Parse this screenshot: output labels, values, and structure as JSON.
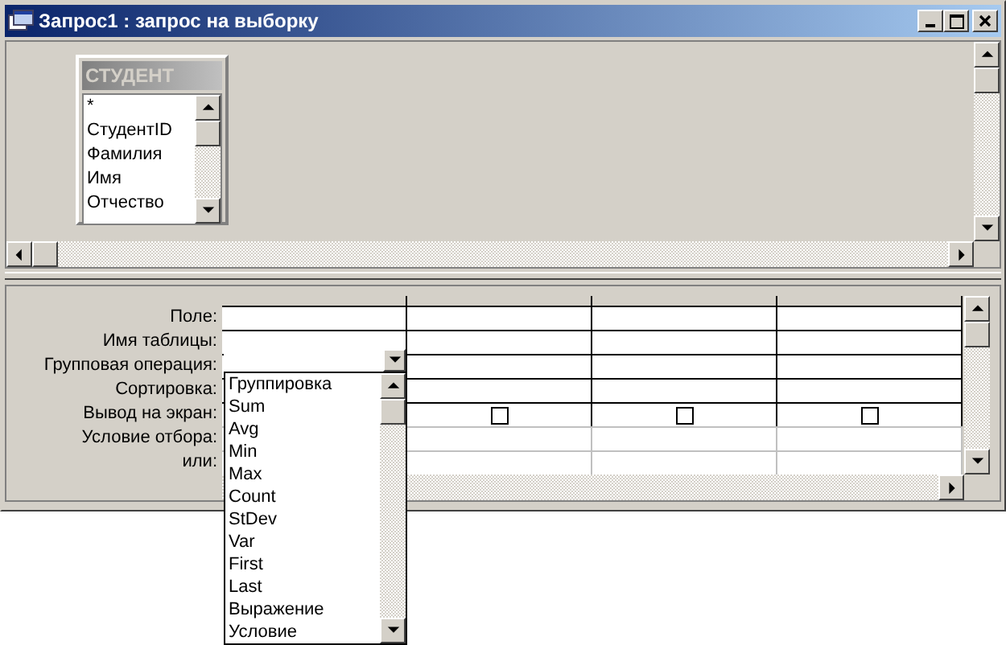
{
  "window": {
    "title": "Запрос1 : запрос на выборку"
  },
  "table_box": {
    "title": "СТУДЕНТ",
    "fields": [
      "*",
      "СтудентID",
      "Фамилия",
      "Имя",
      "Отчество"
    ]
  },
  "grid": {
    "row_labels": [
      "Поле:",
      "Имя таблицы:",
      "Групповая операция:",
      "Сортировка:",
      "Вывод на экран:",
      "Условие отбора:",
      "или:"
    ],
    "show_checkboxes": [
      {
        "checked": false
      },
      {
        "checked": false
      },
      {
        "checked": false
      }
    ]
  },
  "dropdown": {
    "items": [
      "Группировка",
      "Sum",
      "Avg",
      "Min",
      "Max",
      "Count",
      "StDev",
      "Var",
      "First",
      "Last",
      "Выражение",
      "Условие"
    ]
  }
}
